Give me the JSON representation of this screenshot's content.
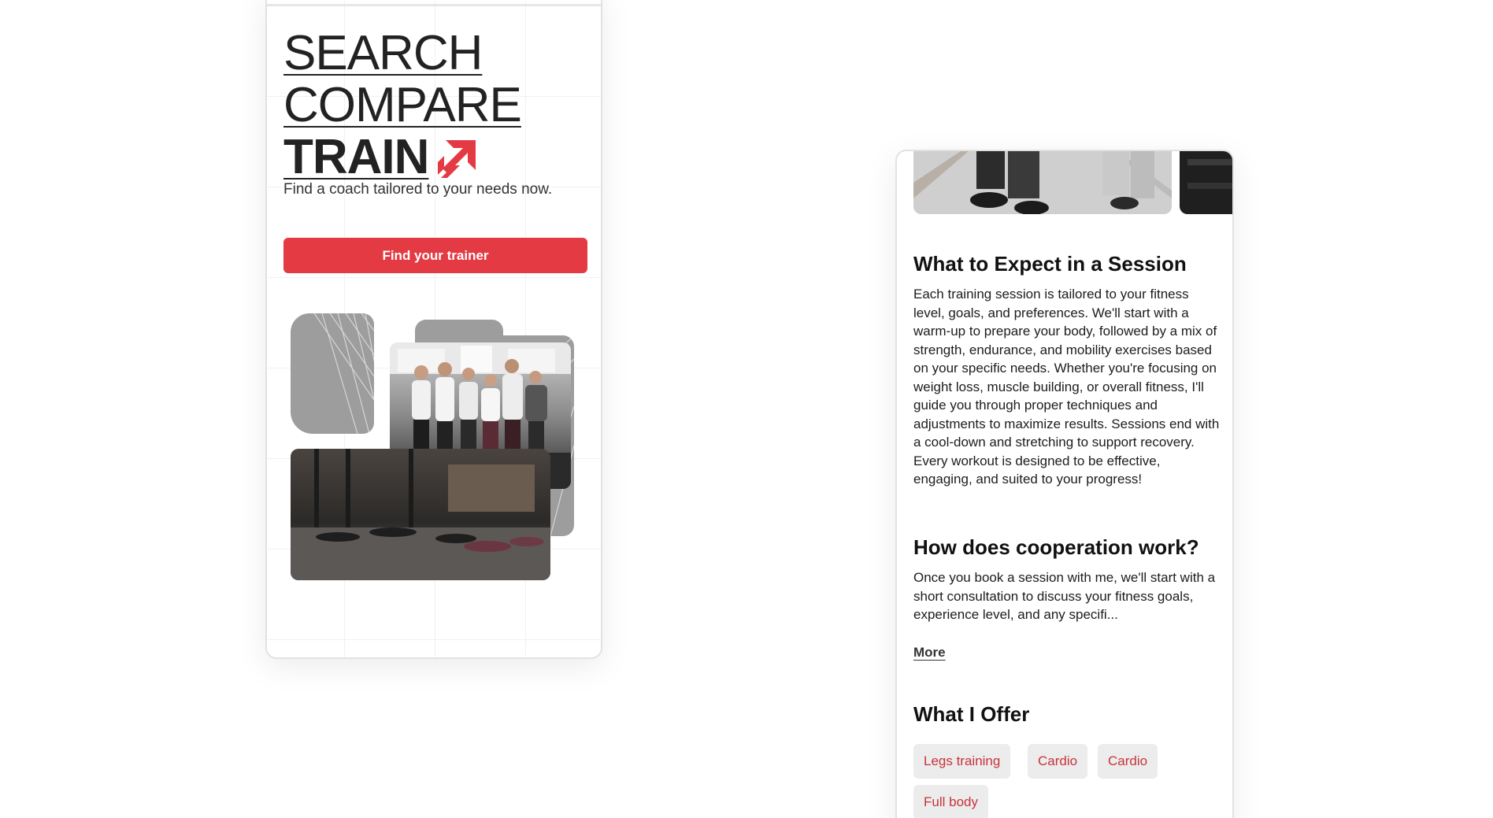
{
  "hero": {
    "line1": "SEARCH",
    "line2": "COMPARE",
    "line3": "TRAIN",
    "subtitle": "Find a coach tailored to your needs now.",
    "cta_label": "Find your trainer"
  },
  "session": {
    "title": "What to Expect in a Session",
    "body": "Each training session is tailored to your fitness level, goals, and preferences. We'll start with a warm-up to prepare your body, followed by a mix of strength, endurance, and mobility exercises based on your specific needs. Whether you're focusing on weight loss, muscle building, or overall fitness, I'll guide you through proper techniques and adjustments to maximize results. Sessions end with a cool-down and stretching to support recovery. Every workout is designed to be effective, engaging, and suited to your progress!"
  },
  "cooperation": {
    "title": "How does cooperation work?",
    "body": "Once you book a session with me, we'll start with a short consultation to discuss your fitness goals, experience level, and any specifi...",
    "more_label": "More"
  },
  "offer": {
    "title": "What I Offer",
    "tags": [
      "Legs training",
      "Cardio",
      "Cardio",
      "Full body"
    ]
  },
  "colors": {
    "accent": "#e43a44",
    "tag_text": "#c8333b",
    "tag_bg": "#ececec"
  },
  "icons": {
    "logo": "red-diagonal-arrow-icon"
  }
}
